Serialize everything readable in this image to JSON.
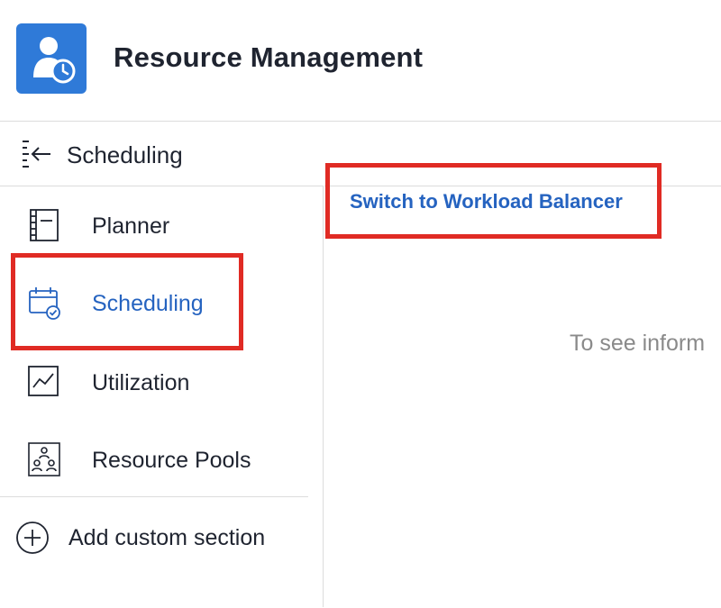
{
  "header": {
    "title": "Resource Management",
    "logo_icon": "resource-clock-icon",
    "logo_color": "#2f7ad8"
  },
  "section": {
    "collapse_icon": "collapse-left-icon",
    "title": "Scheduling"
  },
  "sidebar": {
    "items": [
      {
        "label": "Planner",
        "icon": "planner-icon",
        "active": false
      },
      {
        "label": "Scheduling",
        "icon": "calendar-check-icon",
        "active": true
      },
      {
        "label": "Utilization",
        "icon": "line-chart-icon",
        "active": false
      },
      {
        "label": "Resource Pools",
        "icon": "resource-pools-icon",
        "active": false
      }
    ],
    "add_section_label": "Add custom section",
    "add_icon": "plus-circle-icon"
  },
  "main": {
    "switch_link": "Switch to Workload Balancer",
    "empty_state": "To see inform"
  },
  "colors": {
    "accent": "#2563c0",
    "highlight": "#e02b24",
    "text": "#1f2430",
    "muted": "#8a8a8a"
  }
}
